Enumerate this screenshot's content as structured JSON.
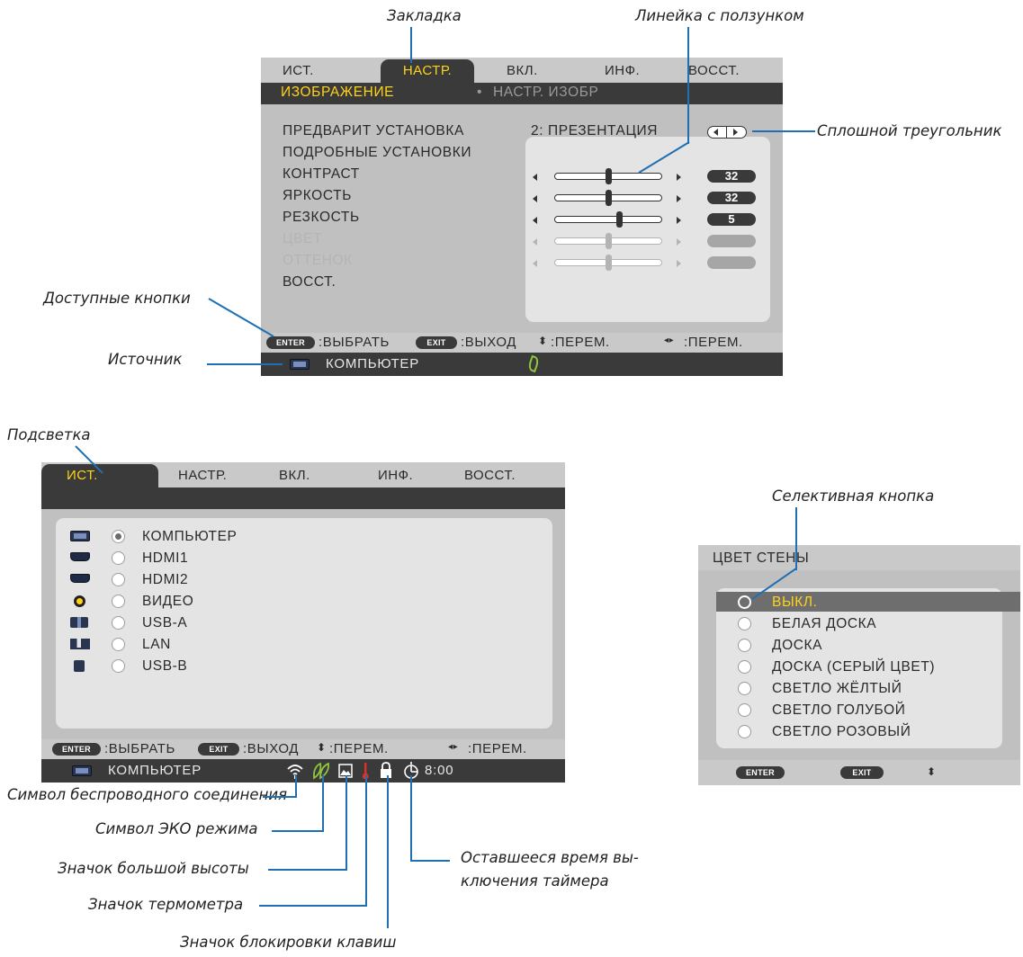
{
  "callouts": {
    "tab": "Закладка",
    "slider": "Линейка с ползунком",
    "solid_triangle": "Сплошной треугольник",
    "available_buttons": "Доступные кнопки",
    "source": "Источник",
    "highlight": "Подсветка",
    "selective_button": "Селективная кнопка",
    "wireless_symbol": "Символ беспроводного соединения",
    "eco_symbol": "Символ ЭКО режима",
    "high_altitude_icon": "Значок большой высоты",
    "thermometer_icon": "Значок термометра",
    "key_lock_icon": "Значок блокировки клавиш",
    "timer_line1": "Оставшееся время вы-",
    "timer_line2": "ключения таймера"
  },
  "menu1": {
    "tabs": [
      "ИСТ.",
      "НАСТР.",
      "ВКЛ.",
      "ИНФ.",
      "ВОССТ."
    ],
    "active_tab_index": 1,
    "subtabs": [
      "ИЗОБРАЖЕНИЕ",
      "НАСТР. ИЗОБР"
    ],
    "subtab_bullet": "•",
    "items": [
      "ПРЕДВАРИТ УСТАНОВКА",
      "ПОДРОБНЫЕ УСТАНОВКИ",
      "КОНТРАСТ",
      "ЯРКОСТЬ",
      "РЕЗКОСТЬ",
      "ЦВЕТ",
      "ОТТЕНОК",
      "ВОССТ."
    ],
    "preset_value": "2:  ПРЕЗЕНТАЦИЯ",
    "sliders": [
      {
        "name": "КОНТРАСТ",
        "value": "32",
        "level": 0.5,
        "enabled": true
      },
      {
        "name": "ЯРКОСТЬ",
        "value": "32",
        "level": 0.5,
        "enabled": true
      },
      {
        "name": "РЕЗКОСТЬ",
        "value": "5",
        "level": 0.6,
        "enabled": true
      },
      {
        "name": "ЦВЕТ",
        "value": "",
        "level": 0.5,
        "enabled": false
      },
      {
        "name": "ОТТЕНОК",
        "value": "",
        "level": 0.5,
        "enabled": false
      }
    ],
    "footer": {
      "enter_key": "ENTER",
      "select": ":ВЫБРАТЬ",
      "exit_key": "EXIT",
      "exit": ":ВЫХОД",
      "move_v": ":ПЕРЕМ.",
      "move_h": ":ПЕРЕМ."
    },
    "source": "КОМПЬЮТЕР"
  },
  "menu2": {
    "tabs": [
      "ИСТ.",
      "НАСТР.",
      "ВКЛ.",
      "ИНФ.",
      "ВОССТ."
    ],
    "active_tab_index": 0,
    "sources": [
      {
        "icon": "computer-icon",
        "label": "КОМПЬЮТЕР",
        "selected": true
      },
      {
        "icon": "hdmi-icon",
        "label": "HDMI1",
        "selected": false
      },
      {
        "icon": "hdmi-icon",
        "label": "HDMI2",
        "selected": false
      },
      {
        "icon": "video-icon",
        "label": "ВИДЕО",
        "selected": false
      },
      {
        "icon": "usb-a-icon",
        "label": "USB-A",
        "selected": false
      },
      {
        "icon": "lan-icon",
        "label": "LAN",
        "selected": false
      },
      {
        "icon": "usb-b-icon",
        "label": "USB-B",
        "selected": false
      }
    ],
    "footer": {
      "enter_key": "ENTER",
      "select": ":ВЫБРАТЬ",
      "exit_key": "EXIT",
      "exit": ":ВЫХОД",
      "move_v": ":ПЕРЕМ.",
      "move_h": ":ПЕРЕМ."
    },
    "source": "КОМПЬЮТЕР",
    "timer": "8:00"
  },
  "menu3": {
    "title": "ЦВЕТ СТЕНЫ",
    "options": [
      "ВЫКЛ.",
      "БЕЛАЯ ДОСКА",
      "ДОСКА",
      "ДОСКА (СЕРЫЙ ЦВЕТ)",
      "СВЕТЛО ЖЁЛТЫЙ",
      "СВЕТЛО ГОЛУБОЙ",
      "СВЕТЛО РОЗОВЫЙ"
    ],
    "selected_index": 0,
    "footer": {
      "enter_key": "ENTER",
      "exit_key": "EXIT"
    }
  },
  "colors": {
    "accent_yellow": "#ffd21a",
    "leader_blue": "#1f6fb2",
    "panel_dark": "#3a3a3a",
    "panel_light": "#c9c9c9"
  }
}
